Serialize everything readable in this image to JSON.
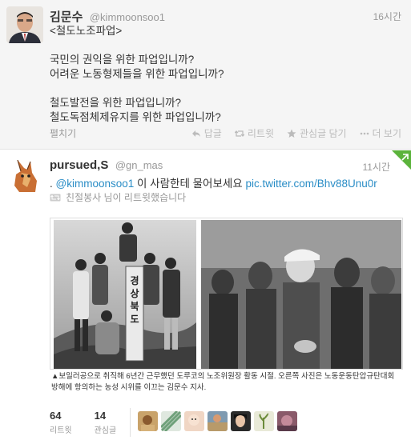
{
  "tweet1": {
    "fullname": "김문수",
    "handle": "@kimmoonsoo1",
    "time": "16시간",
    "lines": [
      "<철도노조파업>",
      "",
      "국민의 권익을 위한 파업입니까?",
      "어려운 노동형제들을 위한 파업입니까?",
      "",
      "철도발전을 위한 파업입니까?",
      "철도독점체제유지를 위한 파업입니까?"
    ],
    "expand": "펼치기",
    "actions": {
      "reply": "답글",
      "retweet": "리트윗",
      "favorite": "관심글 담기",
      "more": "더 보기"
    }
  },
  "tweet2": {
    "fullname": "pursued,S",
    "handle": "@gn_mas",
    "time": "11시간",
    "prefix": ". ",
    "mention": "@kimmoonsoo1",
    "body": " 이 사람한테 물어보세요 ",
    "link": "pic.twitter.com/Bhv88Unu0r",
    "retweeted_by": "친절봉사 님이 리트윗했습니다",
    "sign_text": "경상북도",
    "caption": "▲보일러공으로 취직해 6년간 근무했던 도루코의 노조위원장 활동 시절. 오른쪽 사진은 노동운동탄압규탄대회 방해에 항의하는 농성 시위를 이끄는 김문수 지사.",
    "stats": [
      {
        "num": "64",
        "label": "리트윗"
      },
      {
        "num": "14",
        "label": "관심글"
      }
    ],
    "faces": [
      "face-1",
      "face-2",
      "face-3",
      "face-4",
      "face-5",
      "face-6",
      "face-7"
    ]
  }
}
